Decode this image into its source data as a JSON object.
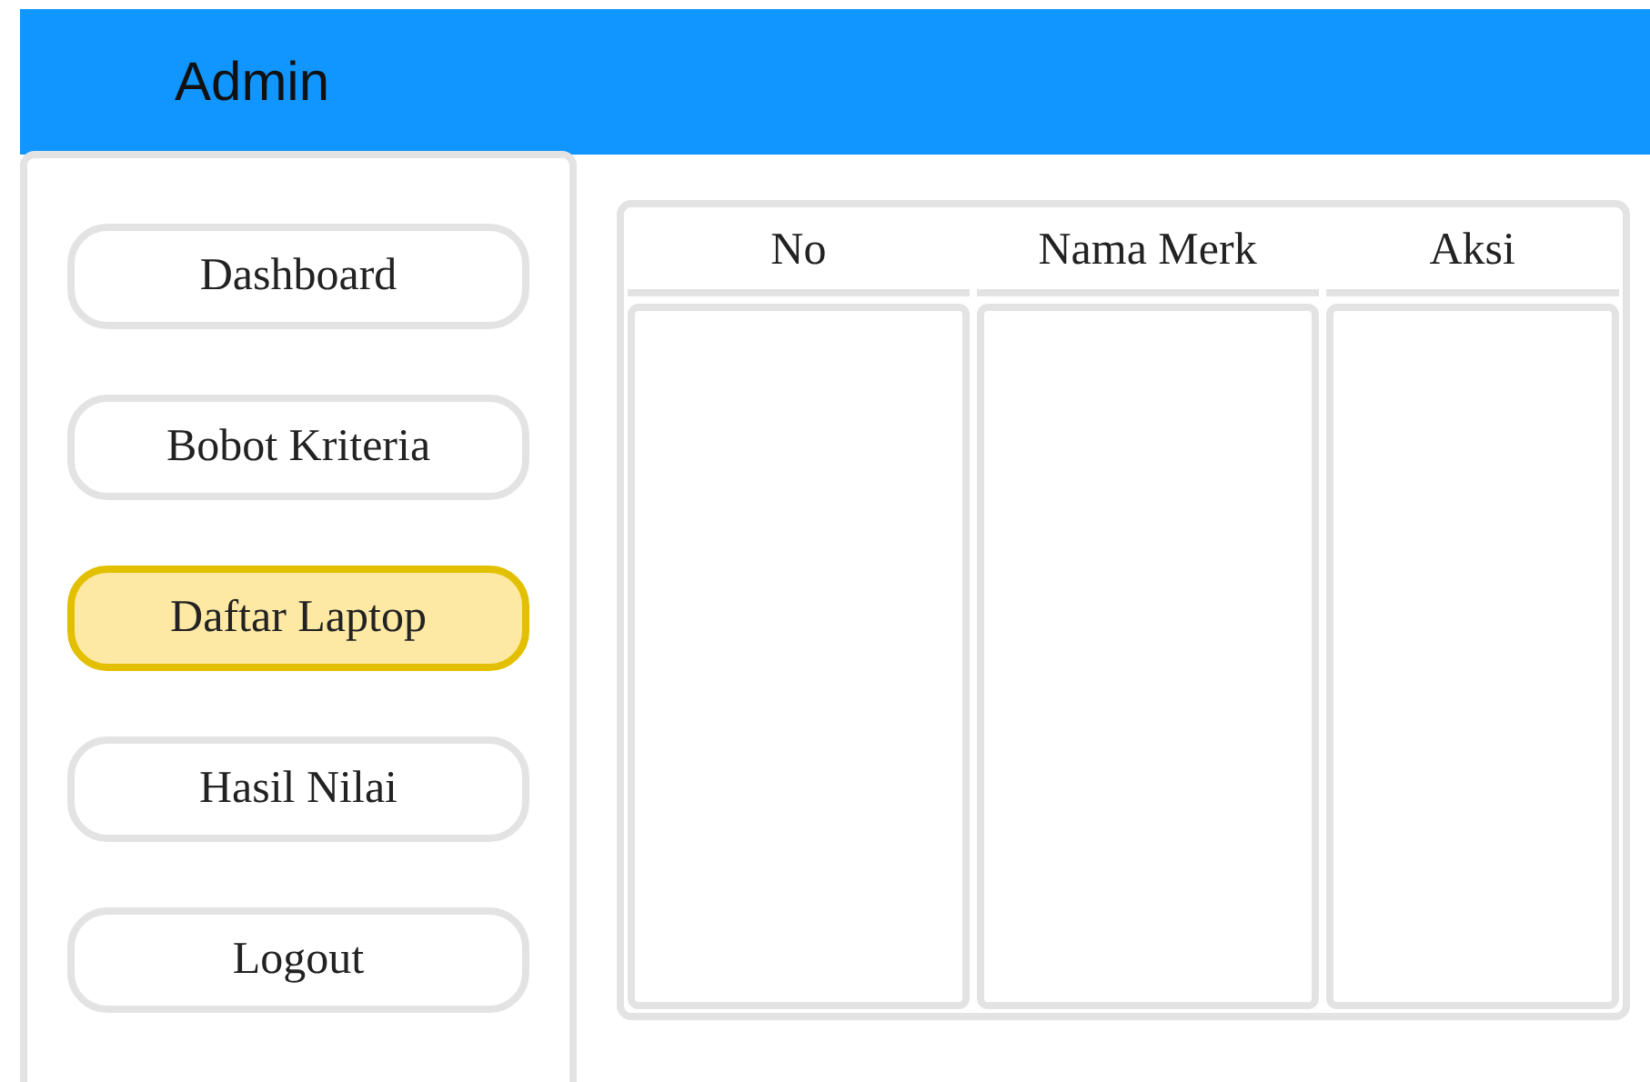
{
  "header": {
    "title": "Admin"
  },
  "sidebar": {
    "items": [
      {
        "label": "Dashboard",
        "selected": false
      },
      {
        "label": "Bobot Kriteria",
        "selected": false
      },
      {
        "label": "Daftar Laptop",
        "selected": true
      },
      {
        "label": "Hasil Nilai",
        "selected": false
      },
      {
        "label": "Logout",
        "selected": false
      }
    ]
  },
  "table": {
    "columns": [
      "No",
      "Nama Merk",
      "Aksi"
    ]
  }
}
